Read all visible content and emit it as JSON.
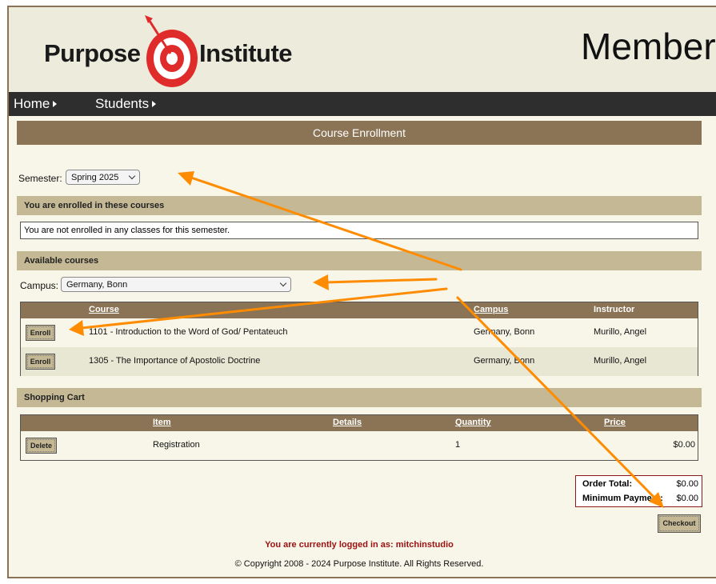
{
  "brand": {
    "name_left": "Purpose",
    "name_right": "Institute",
    "header_title": "Member"
  },
  "nav": {
    "items": [
      {
        "label": "Home"
      },
      {
        "label": "Students"
      }
    ]
  },
  "page": {
    "title": "Course Enrollment"
  },
  "semester": {
    "label": "Semester:",
    "value": "Spring 2025"
  },
  "enrolled": {
    "heading": "You are enrolled in these courses",
    "empty_message": "You are not enrolled in any classes for this semester."
  },
  "available": {
    "heading": "Available courses",
    "campus_label": "Campus:",
    "campus_value": "Germany, Bonn",
    "columns": {
      "course": "Course",
      "campus": "Campus",
      "instructor": "Instructor"
    },
    "rows": [
      {
        "action": "Enroll",
        "course": "1101 - Introduction to the Word of God/ Pentateuch",
        "campus": "Germany, Bonn",
        "instructor": "Murillo, Angel"
      },
      {
        "action": "Enroll",
        "course": "1305 - The Importance of Apostolic Doctrine",
        "campus": "Germany, Bonn",
        "instructor": "Murillo, Angel"
      }
    ]
  },
  "cart": {
    "heading": "Shopping Cart",
    "columns": {
      "item": "Item",
      "details": "Details",
      "quantity": "Quantity",
      "price": "Price"
    },
    "rows": [
      {
        "action": "Delete",
        "item": "Registration",
        "details": "",
        "quantity": "1",
        "price": "$0.00"
      }
    ]
  },
  "totals": {
    "order_label": "Order Total:",
    "order_value": "$0.00",
    "minimum_label": "Minimum Payment:",
    "minimum_value": "$0.00"
  },
  "checkout_label": "Checkout",
  "footer": {
    "logged_in": "You are currently logged in as: mitchinstudio",
    "copyright": "© Copyright 2008 - 2024 Purpose Institute. All Rights Reserved."
  },
  "colors": {
    "brown": "#8b7355",
    "tan": "#c5b995",
    "cream": "#f7f6e9",
    "nav": "#2e2e2e",
    "annotation": "#ff8c00",
    "alert": "#9b1111"
  }
}
